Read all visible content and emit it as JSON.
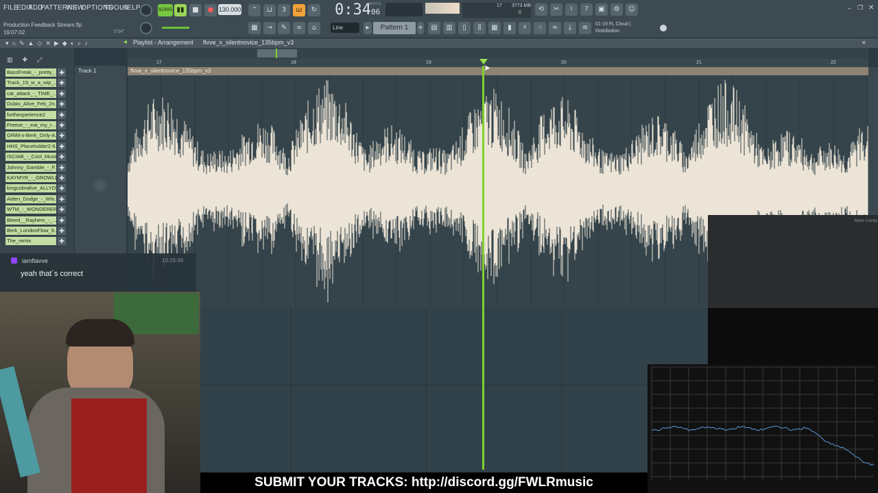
{
  "menu": [
    "FILE",
    "EDIT",
    "ADD",
    "PATTERNS",
    "VIEW",
    "OPTIONS",
    "TOOLS",
    "HELP"
  ],
  "transport": {
    "mode": "SONG",
    "tempo": "130.000",
    "time_main": "0:34",
    "time_sub": "06",
    "time_unit": "M:S:CS",
    "cpu": "17",
    "memory": "3773 MB",
    "voices": "0"
  },
  "project": {
    "file": "Production Feedback Stream.flp",
    "elapsed": "19:07:02",
    "hint_time": "0'34\""
  },
  "toolbar": {
    "snap": "Line",
    "pattern": "Pattern 1",
    "news_line1": "01-19  FL Cloud |",
    "news_line2": "Distribution"
  },
  "playlist": {
    "title": "Playlist - Arrangement",
    "clip": "flvve_x_silentnovice_135bpm_v3",
    "track": "Track 1",
    "bars": [
      "17",
      "18",
      "19",
      "20",
      "21",
      "22"
    ],
    "items": [
      "BassFreak_-_pretty_...",
      "Track_19_w_a_wip_...",
      "cat_attack_-_TIME_...",
      "Dubio_Alive_Feb_2n...",
      "forthexperience2",
      "Freexe_-_eat_my_r...",
      "GRiM-x-Berk_Only-A...",
      "HHS_Placeholder2-9...",
      "ISCIAB_-_Cool_Music...",
      "Johnny_Gamble_-_F...",
      "KAYMYR_-_GROWLER...",
      "kingcobralive_ALLYO...",
      "Aiden_Dodge_-_Whi...",
      "WTM_-_WONDERER_...",
      "Bleed__Rayhem_-_...",
      "Berk_LondonFlow_9...",
      "The_remix"
    ]
  },
  "chat": {
    "user": "iamflavve",
    "time": "19:26:49",
    "message": "yeah that´s correct"
  },
  "overlay": {
    "plugin": "Wave Candy"
  },
  "banner": "SUBMIT YOUR TRACKS: http://discord.gg/FWLRmusic",
  "colors": {
    "playhead": "#7fd130",
    "accent": "#f2a23a",
    "clip": "#8d8371",
    "waveform": "#ece4d6"
  }
}
